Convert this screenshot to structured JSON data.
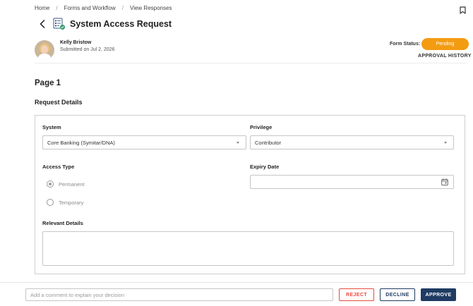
{
  "breadcrumb": {
    "items": [
      "Home",
      "Forms and Workflow",
      "View Responses"
    ],
    "separator": "/"
  },
  "header": {
    "title": "System Access Request",
    "back_icon": "chevron-left-icon",
    "form_icon": "form-document-icon",
    "bookmark_icon": "bookmark-icon"
  },
  "submitter": {
    "name": "Kelly Bristow",
    "submitted": "Submitted on Jul 2, 2026"
  },
  "status": {
    "label": "Form Status:",
    "value": "Pending",
    "color": "#f39c12",
    "history_link": "APPROVAL HISTORY"
  },
  "page": {
    "title": "Page 1",
    "section_title": "Request Details"
  },
  "fields": {
    "system": {
      "label": "System",
      "value": "Core Banking (Symitar/DNA)"
    },
    "privilege": {
      "label": "Privilege",
      "value": "Contributor"
    },
    "access_type": {
      "label": "Access Type",
      "options": [
        {
          "label": "Permanent",
          "checked": true
        },
        {
          "label": "Temporary",
          "checked": false
        }
      ]
    },
    "expiry_date": {
      "label": "Expiry Date",
      "value": "",
      "icon": "calendar-icon"
    },
    "relevant_details": {
      "label": "Relevant Details",
      "value": ""
    }
  },
  "footer": {
    "comment_placeholder": "Add a comment to explain your decision",
    "reject_label": "REJECT",
    "decline_label": "DECLINE",
    "approve_label": "APPROVE",
    "colors": {
      "reject": "#e74c3c",
      "primary": "#1f3b63"
    }
  }
}
